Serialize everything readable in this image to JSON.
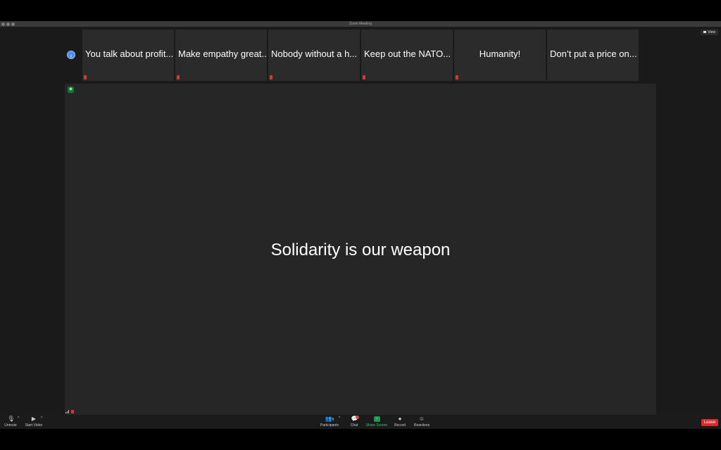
{
  "window": {
    "title": "Zoom Meeting"
  },
  "view_button": {
    "label": "View"
  },
  "gallery": {
    "tiles": [
      {
        "label": "You talk about profit..."
      },
      {
        "label": "Make empathy great..."
      },
      {
        "label": "Nobody without a h..."
      },
      {
        "label": "Keep out the NATO..."
      },
      {
        "label": "Humanity!"
      },
      {
        "label": "Don’t put a price on..."
      }
    ]
  },
  "active_speaker": {
    "name": "Solidarity is our weapon"
  },
  "toolbar": {
    "unmute": "Unmute",
    "start_video": "Start Video",
    "participants": "Participants",
    "participants_count": "8",
    "chat": "Chat",
    "share_screen": "Share Screen",
    "record": "Record",
    "reactions": "Reactions",
    "leave": "Leave"
  },
  "colors": {
    "share_green": "#1a9a4a",
    "leave_red": "#d92c2c",
    "nav_blue": "#4a8cf0"
  }
}
